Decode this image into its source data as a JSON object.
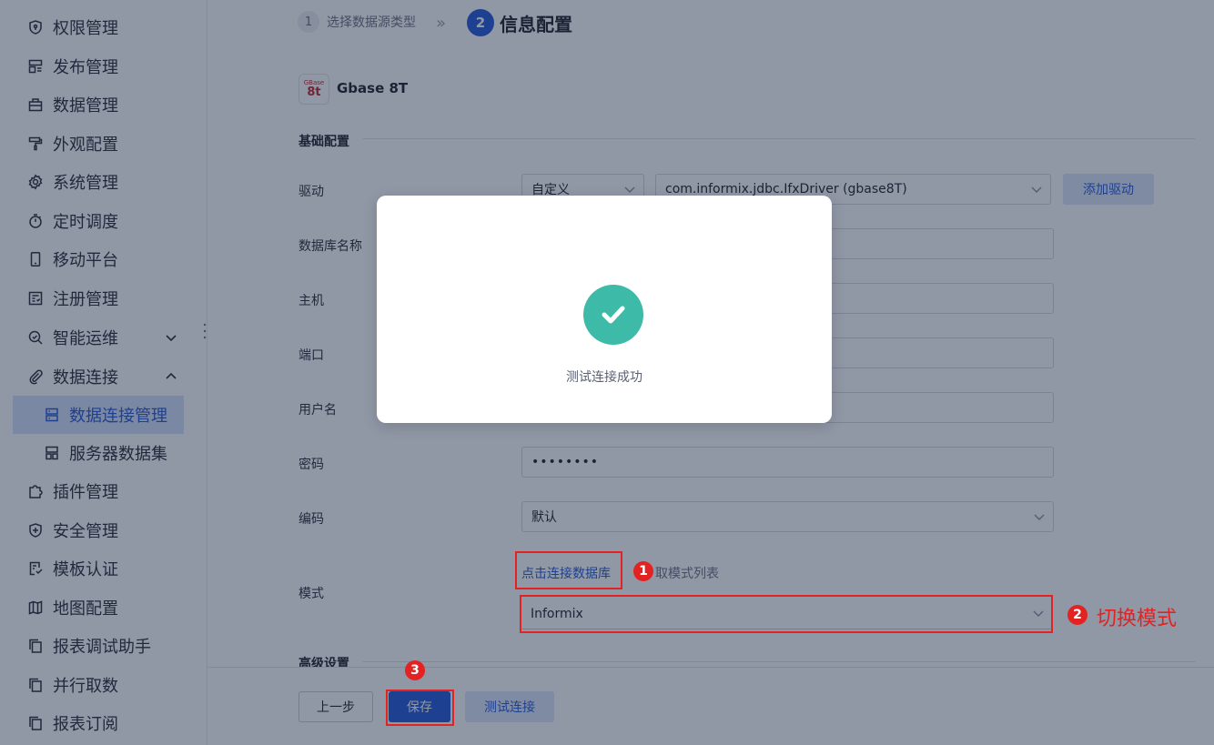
{
  "sidebar": {
    "items": [
      {
        "label": "权限管理",
        "icon": "shield-icon"
      },
      {
        "label": "发布管理",
        "icon": "publish-icon"
      },
      {
        "label": "数据管理",
        "icon": "database-icon"
      },
      {
        "label": "外观配置",
        "icon": "paint-roller-icon"
      },
      {
        "label": "系统管理",
        "icon": "gear-icon"
      },
      {
        "label": "定时调度",
        "icon": "stopwatch-icon"
      },
      {
        "label": "移动平台",
        "icon": "mobile-icon"
      },
      {
        "label": "注册管理",
        "icon": "register-icon"
      },
      {
        "label": "智能运维",
        "icon": "smart-ops-icon"
      },
      {
        "label": "数据连接",
        "icon": "paperclip-icon"
      },
      {
        "label": "数据连接管理",
        "icon": "server-icon"
      },
      {
        "label": "服务器数据集",
        "icon": "dataset-icon"
      },
      {
        "label": "插件管理",
        "icon": "puzzle-icon"
      },
      {
        "label": "安全管理",
        "icon": "security-shield-icon"
      },
      {
        "label": "模板认证",
        "icon": "template-auth-icon"
      },
      {
        "label": "地图配置",
        "icon": "map-icon"
      },
      {
        "label": "报表调试助手",
        "icon": "copy-icon"
      },
      {
        "label": "并行取数",
        "icon": "copy-icon"
      },
      {
        "label": "报表订阅",
        "icon": "copy-icon"
      }
    ]
  },
  "steps": {
    "step1": {
      "num": "1",
      "label": "选择数据源类型"
    },
    "arrow": "»",
    "step2": {
      "num": "2",
      "label": "信息配置"
    }
  },
  "db": {
    "logo_top": "GBase",
    "logo_bottom": "8t",
    "name": "Gbase 8T"
  },
  "form": {
    "section_basic": "基础配置",
    "labels": {
      "driver": "驱动",
      "dbname": "数据库名称",
      "host": "主机",
      "port": "端口",
      "username": "用户名",
      "password": "密码",
      "encoding": "编码",
      "schema": "模式"
    },
    "driver_type": "自定义",
    "driver_class": "com.informix.jdbc.IfxDriver (gbase8T)",
    "add_driver": "添加驱动",
    "password_mask": "••••••••",
    "encoding_value": "默认",
    "connect_link": "点击连接数据库",
    "fetch_schema_hint": "取模式列表",
    "schema_value": "Informix",
    "section_advanced": "高级设置"
  },
  "footer": {
    "prev": "上一步",
    "save": "保存",
    "test": "测试连接"
  },
  "modal": {
    "message": "测试连接成功"
  },
  "annotations": {
    "badge1": "1",
    "badge2": "2",
    "badge3": "3",
    "switch_text": "切换模式"
  },
  "colors": {
    "primary": "#2458d6",
    "success": "#3dbaa8",
    "annotation": "#e32222"
  }
}
